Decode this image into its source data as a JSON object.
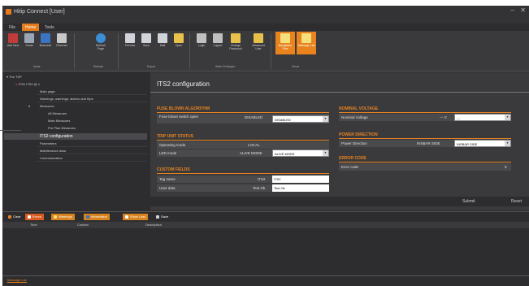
{
  "window": {
    "title": "Hitip Connect [User]"
  },
  "menu_tabs": [
    "File",
    "Home",
    "Tools"
  ],
  "menu_tabs_active": 1,
  "ribbon": {
    "buttons": [
      {
        "label": "Add New",
        "icon": "add-device-icon",
        "color": "#c23b3b"
      },
      {
        "label": "Serial",
        "icon": "serial-port-icon",
        "color": "#9aa6b5"
      },
      {
        "label": "Bluetooth",
        "icon": "bluetooth-icon",
        "color": "#3b74c2"
      },
      {
        "label": "Ethernet",
        "icon": "ethernet-icon",
        "color": "#c8c8c8"
      },
      {
        "label": "Refresh Page",
        "icon": "refresh-icon",
        "color": "#3b8fd6"
      },
      {
        "label": "Preview",
        "icon": "preview-icon",
        "color": "#d0d4da"
      },
      {
        "label": "Save",
        "icon": "save-icon",
        "color": "#d0d4da"
      },
      {
        "label": "Mail",
        "icon": "mail-icon",
        "color": "#d0d4da"
      },
      {
        "label": "Open",
        "icon": "open-folder-icon",
        "color": "#e8c14a"
      },
      {
        "label": "Login",
        "icon": "lock-icon",
        "color": "#c0c0c0"
      },
      {
        "label": "Logout",
        "icon": "unlock-icon",
        "color": "#c0c0c0"
      },
      {
        "label": "Change Password",
        "icon": "key-icon",
        "color": "#e8c14a"
      },
      {
        "label": "Advanced User",
        "icon": "user-icon",
        "color": "#e8c14a"
      },
      {
        "label": "Navigation Tree",
        "icon": "navigation-tree-icon",
        "color": "#f4e07a"
      },
      {
        "label": "Message List",
        "icon": "message-list-icon",
        "color": "#f4e07a"
      }
    ],
    "groups": [
      "Mode",
      "Refresh",
      "Export",
      "Write Privileges",
      "Views"
    ]
  },
  "tree": {
    "root": "The TSP",
    "device": "ITS2 ITS2 @ 1",
    "items": [
      "Main page",
      "Warnings, warnings, alarms and trips",
      "Measures",
      "All Measures",
      "Main Measures",
      "Pre Plan Measures",
      "ITS2 configuration",
      "Parameters",
      "Maintenance data",
      "Communication"
    ]
  },
  "panel": {
    "title": "ITS2 configuration",
    "fuse": {
      "heading": "FUSE BLOWN ALGORITHM",
      "label": "Fuse blown switch open",
      "value": "DISABLED",
      "option": "DISABLED"
    },
    "trip": {
      "heading": "TRIP UNIT STATUS",
      "operating_label": "Operating mode",
      "operating_value": "LOCAL",
      "led_label": "LED mode",
      "led_value": "ALIVE MODE",
      "led_option": "ALIVE MODE"
    },
    "custom": {
      "heading": "CUSTOM FIELDS",
      "tag_label": "Tag name",
      "tag_prefix": "ITS2",
      "tag_value": "ITS2",
      "user_label": "User data",
      "user_prefix": "Test Ok",
      "user_value": "Test Ok"
    },
    "nominal": {
      "heading": "NOMINAL VOLTAGE",
      "label": "Nominal Voltage",
      "value": "--- V",
      "option": "---"
    },
    "power": {
      "heading": "POWER DIRECTION",
      "label": "Power Direction",
      "value": "INSBAR SIDE",
      "option": "INSBAR SIDE"
    },
    "error": {
      "heading": "ERROR CODE",
      "label": "Error code",
      "value": "0"
    },
    "submit_label": "Submit",
    "reset_label": "Reset"
  },
  "messages": {
    "toolbar": [
      {
        "label": "Clear",
        "color": "#2d2d30",
        "icon": "clear-icon"
      },
      {
        "label": "Errors",
        "color": "#d85a1e",
        "icon": "error-icon"
      },
      {
        "label": "Warnings",
        "color": "#d8821e",
        "icon": "warning-icon"
      },
      {
        "label": "Information",
        "color": "#d8821e",
        "icon": "information-icon"
      },
      {
        "label": "Show Last",
        "color": "#d8821e",
        "icon": "show-last-icon"
      },
      {
        "label": "Save",
        "color": "#2d2d30",
        "icon": "save-icon"
      }
    ],
    "columns": [
      "Time",
      "Context",
      "Description"
    ]
  },
  "footer": {
    "tab": "Message List"
  },
  "colors": {
    "accent": "#e8831e",
    "background": "#2d2d30",
    "panel": "#3a3a3d"
  }
}
